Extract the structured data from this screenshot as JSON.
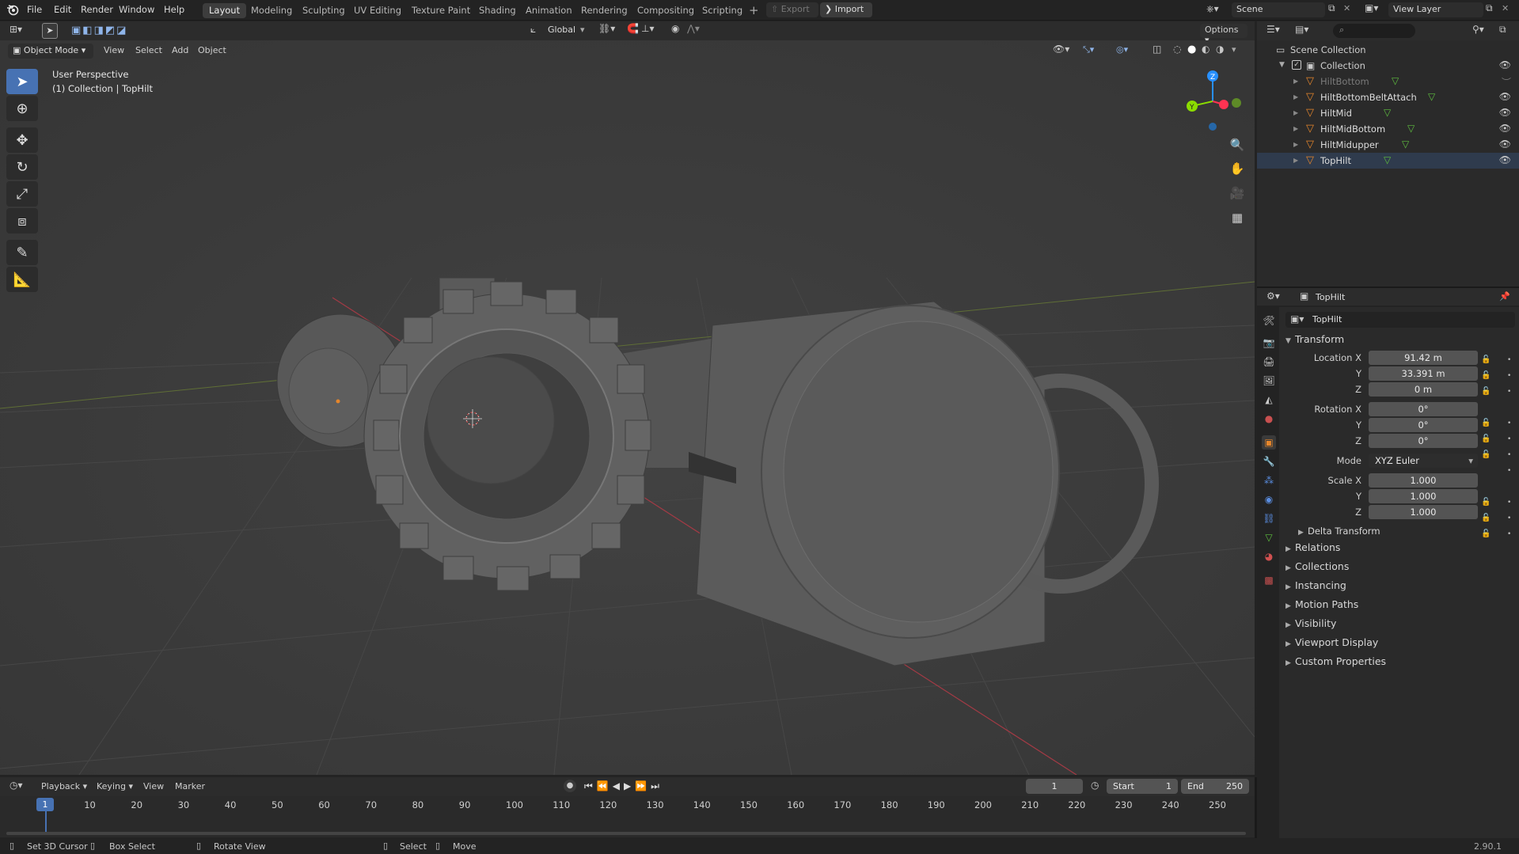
{
  "app": {
    "logo": "blender-logo-icon",
    "version": "2.90.1"
  },
  "menu": [
    "File",
    "Edit",
    "Render",
    "Window",
    "Help"
  ],
  "workspaces": [
    "Layout",
    "Modeling",
    "Sculpting",
    "UV Editing",
    "Texture Paint",
    "Shading",
    "Animation",
    "Rendering",
    "Compositing",
    "Scripting"
  ],
  "active_workspace": "Layout",
  "topbar": {
    "export": "Export",
    "import": "Import",
    "scene": "Scene",
    "view_layer": "View Layer"
  },
  "tool_header": {
    "transform_orientation": "Global",
    "options": "Options"
  },
  "viewport_header": {
    "mode": "Object Mode",
    "menus": [
      "View",
      "Select",
      "Add",
      "Object"
    ]
  },
  "viewport": {
    "perspective": "User Perspective",
    "context": "(1) Collection | TopHilt"
  },
  "outliner": {
    "search_placeholder": "",
    "scene_collection": "Scene Collection",
    "collection": "Collection",
    "objects": [
      {
        "name": "HiltBottom",
        "hidden": true
      },
      {
        "name": "HiltBottomBeltAttach",
        "hidden": false
      },
      {
        "name": "HiltMid",
        "hidden": false
      },
      {
        "name": "HiltMidBottom",
        "hidden": false
      },
      {
        "name": "HiltMidupper",
        "hidden": false
      },
      {
        "name": "TopHilt",
        "hidden": false,
        "active": true
      }
    ]
  },
  "properties": {
    "header_object": "TopHilt",
    "object_name": "TopHilt",
    "transform_title": "Transform",
    "location": {
      "label": "Location X",
      "x": "91.42 m",
      "y": "33.391 m",
      "z": "0 m"
    },
    "rotation": {
      "label": "Rotation X",
      "x": "0°",
      "y": "0°",
      "z": "0°"
    },
    "mode_label": "Mode",
    "mode": "XYZ Euler",
    "scale": {
      "label": "Scale X",
      "x": "1.000",
      "y": "1.000",
      "z": "1.000"
    },
    "axis_y": "Y",
    "axis_z": "Z",
    "delta_transform": "Delta Transform",
    "sections": [
      "Relations",
      "Collections",
      "Instancing",
      "Motion Paths",
      "Visibility",
      "Viewport Display",
      "Custom Properties"
    ]
  },
  "timeline": {
    "menus": [
      "Playback",
      "Keying",
      "View",
      "Marker"
    ],
    "current_frame": "1",
    "start_label": "Start",
    "start": "1",
    "end_label": "End",
    "end": "250",
    "ruler": [
      "10",
      "20",
      "30",
      "40",
      "50",
      "60",
      "70",
      "80",
      "90",
      "100",
      "110",
      "120",
      "130",
      "140",
      "150",
      "160",
      "170",
      "180",
      "190",
      "200",
      "210",
      "220",
      "230",
      "240",
      "250"
    ],
    "ruler_current": "1"
  },
  "statusbar": {
    "items": [
      "Set 3D Cursor",
      "Box Select",
      "Rotate View",
      "Select",
      "Move"
    ]
  },
  "colors": {
    "accent": "#4772b3",
    "x_axis": "#ff3352",
    "y_axis": "#8bdc00",
    "z_axis": "#2890ff",
    "orange": "#e5862b"
  }
}
